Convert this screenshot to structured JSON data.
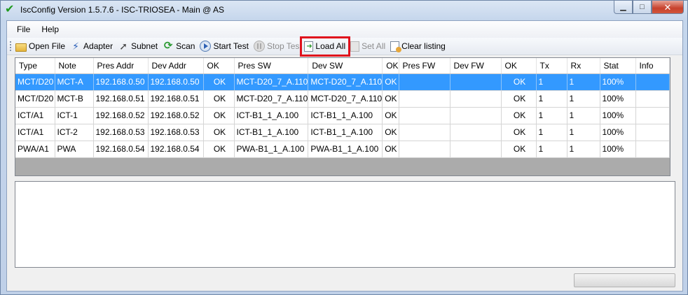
{
  "window": {
    "title": "IscConfig Version 1.5.7.6 - ISC-TRIOSEA - Main @ AS",
    "controls": {
      "minimize": "▁",
      "maximize": "□",
      "close": "✕"
    }
  },
  "menu": {
    "items": [
      {
        "label": "File"
      },
      {
        "label": "Help"
      }
    ]
  },
  "toolbar": {
    "open_file": "Open File",
    "adapter": "Adapter",
    "subnet": "Subnet",
    "scan": "Scan",
    "start_test": "Start Test",
    "stop_test": "Stop Tes",
    "load_all": "Load All",
    "set_all": "Set All",
    "clear_listing": "Clear listing"
  },
  "table": {
    "columns": [
      "Type",
      "Note",
      "Pres Addr",
      "Dev Addr",
      "OK",
      "Pres SW",
      "Dev SW",
      "OK",
      "Pres FW",
      "Dev FW",
      "OK",
      "Tx",
      "Rx",
      "Stat",
      "Info"
    ],
    "rows": [
      [
        "MCT/D20",
        "MCT-A",
        "192.168.0.50",
        "192.168.0.50",
        "OK",
        "MCT-D20_7_A.110",
        "MCT-D20_7_A.110",
        "OK",
        "",
        "",
        "OK",
        "1",
        "1",
        "100%",
        ""
      ],
      [
        "MCT/D20",
        "MCT-B",
        "192.168.0.51",
        "192.168.0.51",
        "OK",
        "MCT-D20_7_A.110",
        "MCT-D20_7_A.110",
        "OK",
        "",
        "",
        "OK",
        "1",
        "1",
        "100%",
        ""
      ],
      [
        "ICT/A1",
        "ICT-1",
        "192.168.0.52",
        "192.168.0.52",
        "OK",
        "ICT-B1_1_A.100",
        "ICT-B1_1_A.100",
        "OK",
        "",
        "",
        "OK",
        "1",
        "1",
        "100%",
        ""
      ],
      [
        "ICT/A1",
        "ICT-2",
        "192.168.0.53",
        "192.168.0.53",
        "OK",
        "ICT-B1_1_A.100",
        "ICT-B1_1_A.100",
        "OK",
        "",
        "",
        "OK",
        "1",
        "1",
        "100%",
        ""
      ],
      [
        "PWA/A1",
        "PWA",
        "192.168.0.54",
        "192.168.0.54",
        "OK",
        "PWA-B1_1_A.100",
        "PWA-B1_1_A.100",
        "OK",
        "",
        "",
        "OK",
        "1",
        "1",
        "100%",
        ""
      ]
    ],
    "selected_row": 0
  },
  "colors": {
    "selection": "#3399ff",
    "highlight_box": "#e0101c",
    "title_check": "#1f9a1f"
  },
  "icons": {
    "open_file": "folder-icon",
    "adapter": "plug-icon",
    "subnet": "cursor-icon",
    "scan": "refresh-icon",
    "start_test": "play-icon",
    "stop_test": "pause-icon",
    "load_all": "load-icon",
    "set_all": "set-icon",
    "clear_listing": "clear-icon"
  }
}
